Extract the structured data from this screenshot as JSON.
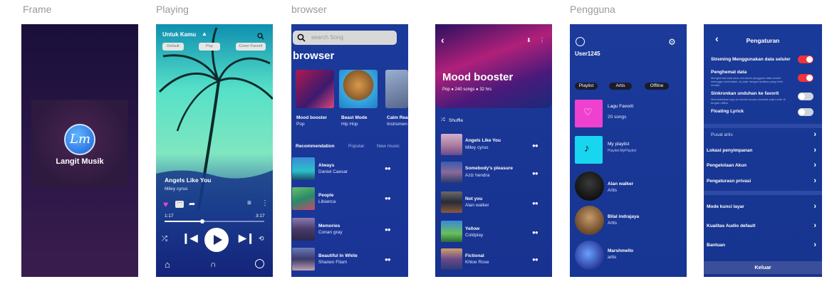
{
  "labels": {
    "frame": "Frame",
    "playing": "Playing",
    "browser": "browser",
    "pengguna": "Pengguna"
  },
  "splash": {
    "logo_text": "Lm",
    "app_name": "Langit Musik"
  },
  "playing": {
    "header": "Untuk Kamu",
    "filters": [
      "Default",
      "Pop",
      "Cover Favorit"
    ],
    "song_title": "Angels Like You",
    "artist": "Miley cyrus",
    "time_current": "1:17",
    "time_total": "3:17",
    "progress": 0.38
  },
  "browser": {
    "search_placeholder": "search Song",
    "heading": "browser",
    "cards": [
      {
        "title": "Mood booster",
        "subtitle": "Pop"
      },
      {
        "title": "Beast Mode",
        "subtitle": "Hip Hop"
      },
      {
        "title": "Calm Rea",
        "subtitle": "Instrumen"
      }
    ],
    "tabs": [
      "Recommendation",
      "Popular",
      "New music"
    ],
    "songs": [
      {
        "title": "Always",
        "artist": "Daniel Caesar"
      },
      {
        "title": "People",
        "artist": "Libianca"
      },
      {
        "title": "Memories",
        "artist": "Conan gray"
      },
      {
        "title": "Beautiful In White",
        "artist": "Shanen Filam"
      }
    ]
  },
  "playlist": {
    "title": "Mood booster",
    "meta_genre": "Pop",
    "meta_songs": "240 songs",
    "meta_duration": "32 hrs",
    "shuffle": "Shuffle",
    "songs": [
      {
        "title": "Angels Like You",
        "artist": "Miley cyrus"
      },
      {
        "title": "Somebody's pleasure",
        "artist": "Aziz hendra"
      },
      {
        "title": "Not you",
        "artist": "Alan walker"
      },
      {
        "title": "Yellow",
        "artist": "Coldplay"
      },
      {
        "title": "Fictional",
        "artist": "Khloe Rose"
      }
    ]
  },
  "pengguna": {
    "username": "User1245",
    "chips": [
      "Playlist",
      "Artis",
      "Offline"
    ],
    "items": [
      {
        "title": "Lagu Favorit",
        "subtitle": "20 songs"
      },
      {
        "title": "My playlist",
        "subtitle": "Playlist-MyPlaylist"
      },
      {
        "title": "Alan walker",
        "subtitle": "Artis"
      },
      {
        "title": "Bilal indrajaya",
        "subtitle": "Artis"
      },
      {
        "title": "Marshmello",
        "subtitle": "artis"
      }
    ]
  },
  "settings": {
    "title": "Pengaturan",
    "toggles": [
      {
        "label": "Streming Menggunakan data seluler",
        "desc": "",
        "on": true
      },
      {
        "label": "Penghemat data",
        "desc": "Menghemat data akan membuat pengguna data seluler sehingga membatasi. di putar dengan kualitas yang lebih rendah",
        "on": true
      },
      {
        "label": "Sinkronkan unduhan ke favorit",
        "desc": "Memindahkan lagu ke favorit secara otomatis saat mode di tengah offline",
        "on": false
      },
      {
        "label": "Floating Lyrick",
        "desc": "",
        "on": false
      }
    ],
    "menu1": [
      "Pusat artis",
      "Lokasi penyimpanan",
      "Pengelolaan Akun",
      "Pengaturasn privasi"
    ],
    "menu2": [
      "Mode kunci layar",
      "Kualitas Audio default",
      "Bantuan"
    ],
    "logout": "Keluar"
  },
  "colors": {
    "accent_red": "#f0333d",
    "favorite_pink": "#f040d0",
    "playlist_cyan": "#19d6f0"
  }
}
